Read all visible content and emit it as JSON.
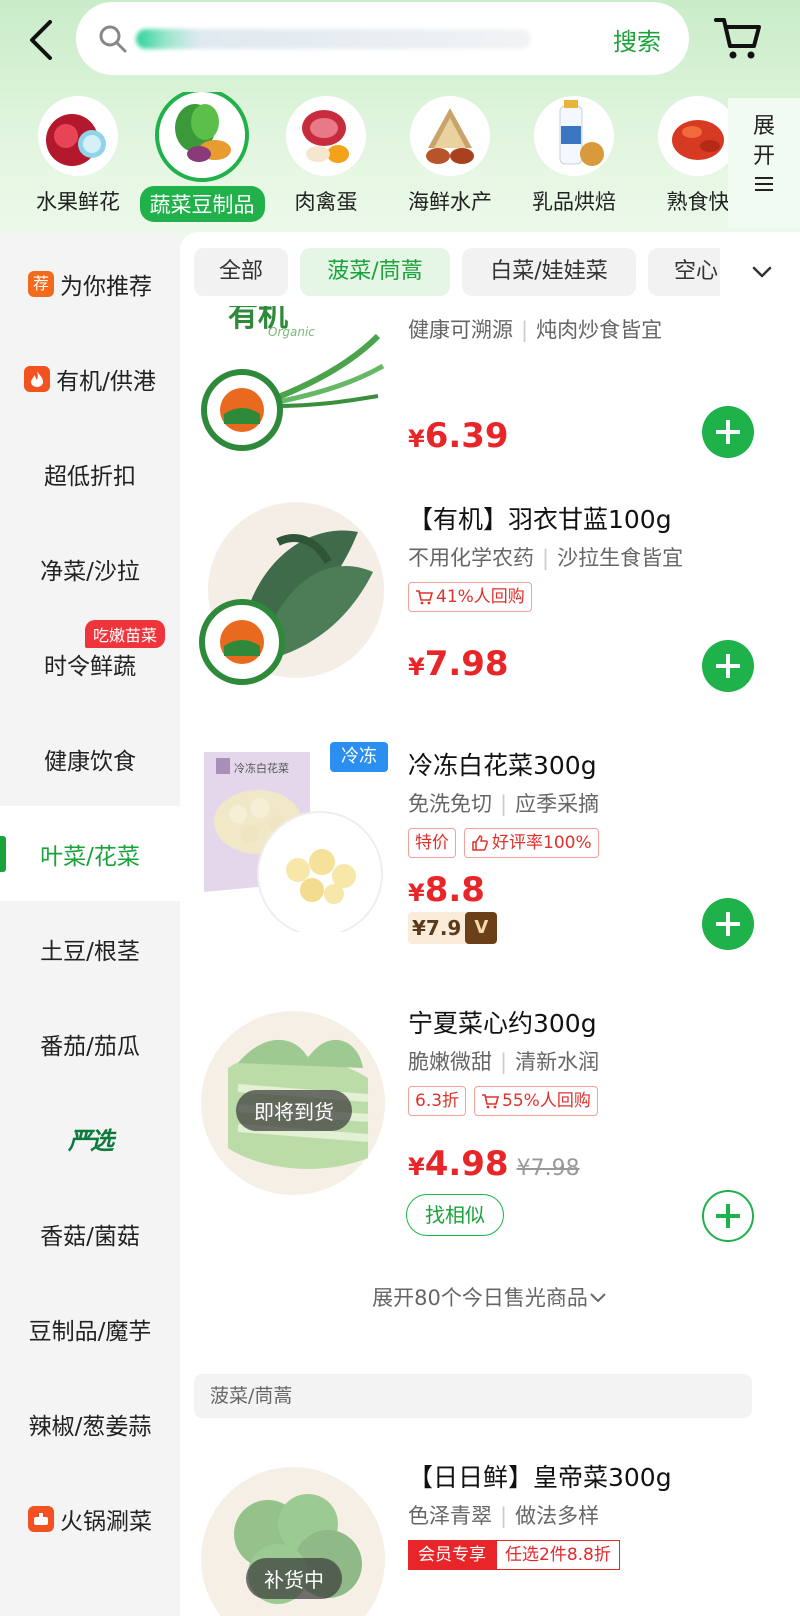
{
  "search": {
    "button_label": "搜索"
  },
  "categories": [
    {
      "label": "水果鲜花",
      "icon": "pomegranate-icon"
    },
    {
      "label": "蔬菜豆制品",
      "icon": "vegetable-icon",
      "selected": true
    },
    {
      "label": "肉禽蛋",
      "icon": "meat-egg-icon"
    },
    {
      "label": "海鲜水产",
      "icon": "seafood-icon"
    },
    {
      "label": "乳品烘焙",
      "icon": "milk-icon"
    },
    {
      "label": "熟食快",
      "icon": "crayfish-icon"
    }
  ],
  "expand_label": "展开",
  "sidebar": {
    "items": [
      {
        "label": "为你推荐",
        "badge_icon": "荐"
      },
      {
        "label": "有机/供港"
      },
      {
        "label": "超低折扣"
      },
      {
        "label": "净菜/沙拉"
      },
      {
        "label": "时令鲜蔬",
        "promo": "吃嫩苗菜"
      },
      {
        "label": "健康饮食"
      },
      {
        "label": "叶菜/花菜",
        "active": true
      },
      {
        "label": "土豆/根茎"
      },
      {
        "label": "番茄/茄瓜"
      },
      {
        "label": "严选"
      },
      {
        "label": "香菇/菌菇"
      },
      {
        "label": "豆制品/魔芋"
      },
      {
        "label": "辣椒/葱姜蒜"
      },
      {
        "label": "火锅涮菜"
      }
    ]
  },
  "tabs": [
    {
      "label": "全部"
    },
    {
      "label": "菠菜/茼蒿",
      "active": true
    },
    {
      "label": "白菜/娃娃菜"
    },
    {
      "label": "空心"
    }
  ],
  "products": [
    {
      "desc_a": "健康可溯源",
      "desc_b": "炖肉炒食皆宜",
      "price_currency": "¥",
      "price": "6.39",
      "logo_text": "有机",
      "logo_sub": "Organic"
    },
    {
      "name": "【有机】羽衣甘蓝100g",
      "desc_a": "不用化学农药",
      "desc_b": "沙拉生食皆宜",
      "tags": [
        "41%人回购"
      ],
      "price_currency": "¥",
      "price": "7.98"
    },
    {
      "name": "冷冻白花菜300g",
      "desc_a": "免洗免切",
      "desc_b": "应季采摘",
      "tags": [
        "特价",
        "好评率100%"
      ],
      "price_currency": "¥",
      "price": "8.8",
      "member_price": "¥7.9",
      "frozen_label": "冷冻",
      "package_text": "冷冻白花菜"
    },
    {
      "name": "宁夏菜心约300g",
      "desc_a": "脆嫩微甜",
      "desc_b": "清新水润",
      "tags": [
        "6.3折",
        "55%人回购"
      ],
      "price_currency": "¥",
      "price": "4.98",
      "orig_price": "¥7.98",
      "status": "即将到货",
      "similar_label": "找相似"
    },
    {
      "name": "【日日鲜】皇帝菜300g",
      "desc_a": "色泽青翠",
      "desc_b": "做法多样",
      "tags": [
        "会员专享",
        "任选2件8.8折"
      ],
      "status": "补货中"
    }
  ],
  "expand_sold_label": "展开80个今日售光商品",
  "section_header": "菠菜/茼蒿",
  "colors": {
    "brand_green": "#1fb24a",
    "price_red": "#e8262a",
    "frozen_blue": "#2a8ff0"
  }
}
